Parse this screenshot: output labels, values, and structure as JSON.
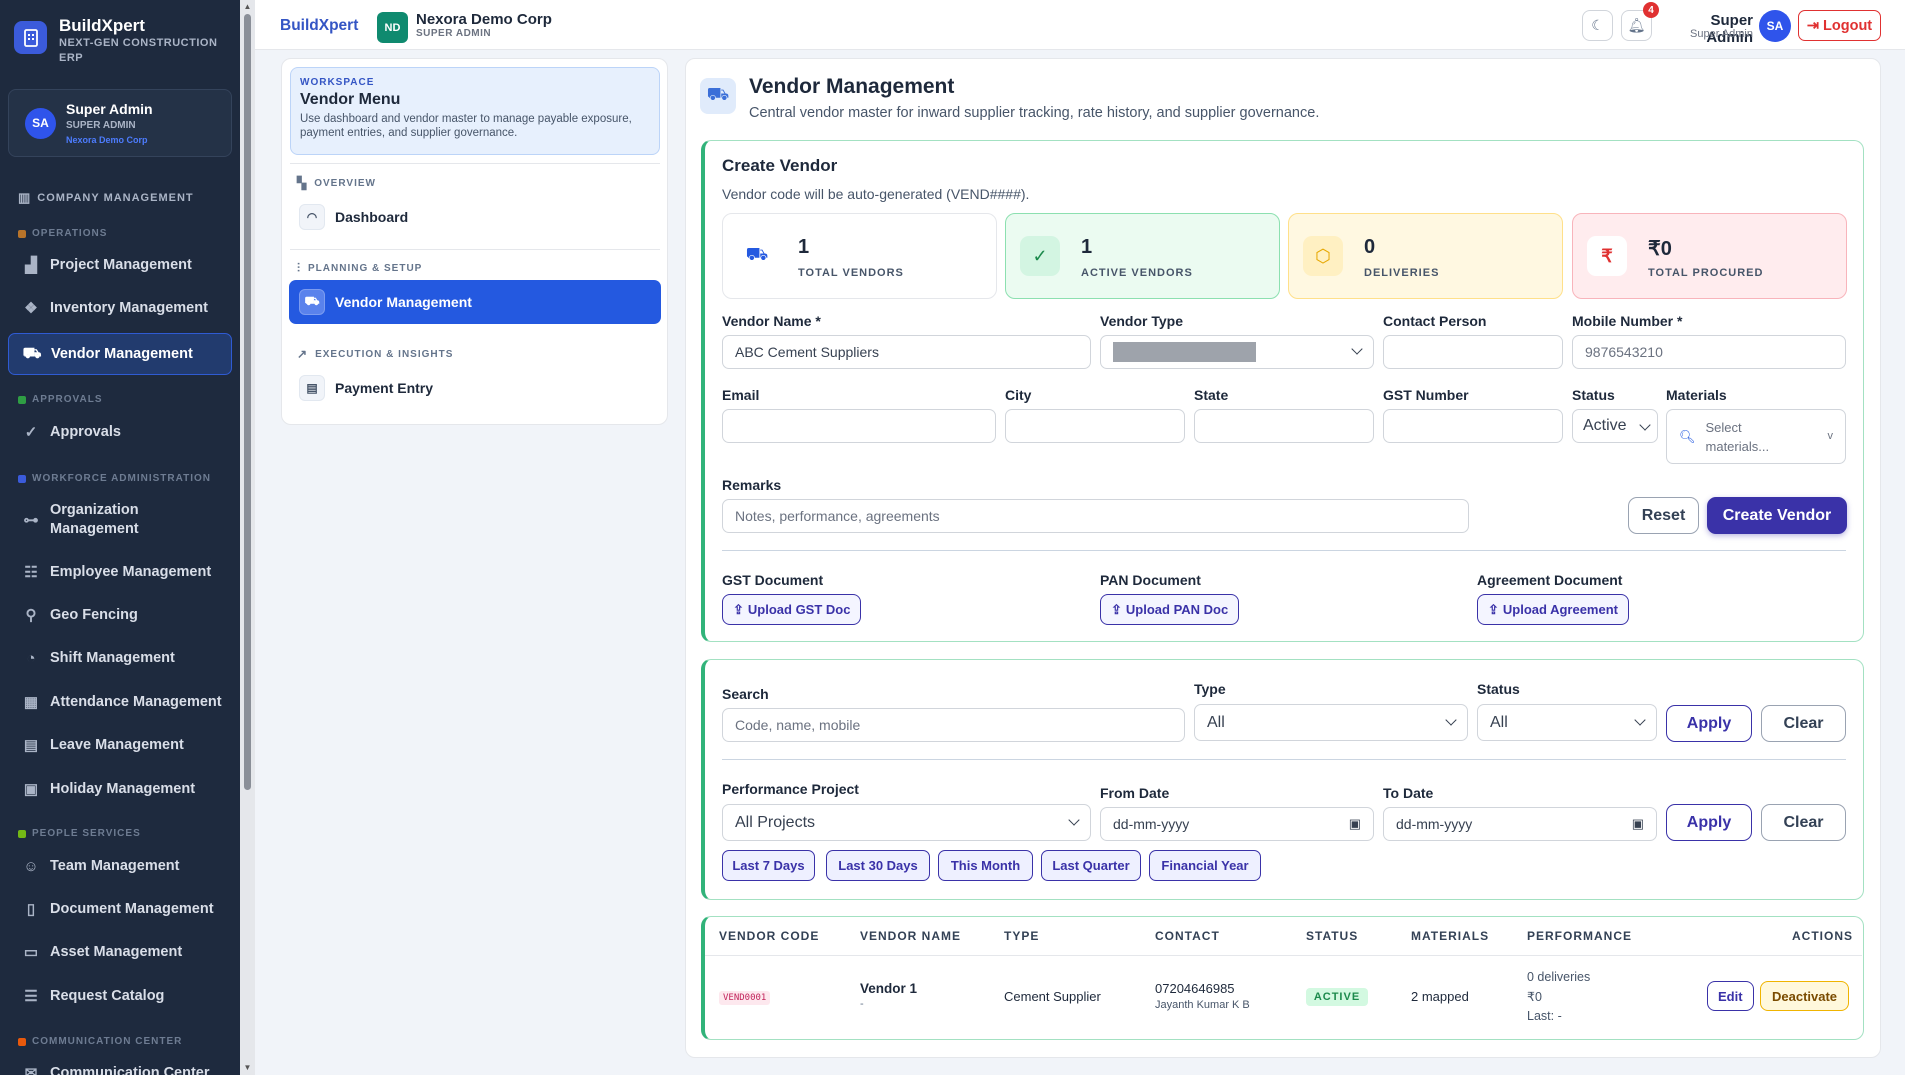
{
  "brand": {
    "name": "BuildXpert",
    "subtitle": "NEXT-GEN CONSTRUCTION ERP"
  },
  "user_card": {
    "initials": "SA",
    "name": "Super Admin",
    "role": "SUPER ADMIN",
    "company": "Nexora Demo Corp"
  },
  "sidebar": {
    "company_management": "COMPANY MANAGEMENT",
    "sections": {
      "operations": "OPERATIONS",
      "approvals": "APPROVALS",
      "workforce": "WORKFORCE ADMINISTRATION",
      "people": "PEOPLE SERVICES",
      "communication": "COMMUNICATION CENTER"
    },
    "items": [
      {
        "label": "Project Management",
        "icon": "chart-icon"
      },
      {
        "label": "Inventory Management",
        "icon": "boxes-icon"
      },
      {
        "label": "Vendor Management",
        "icon": "vendor-icon"
      },
      {
        "label": "Approvals",
        "icon": "check-circle-icon"
      },
      {
        "label": "Organization Management",
        "icon": "org-icon"
      },
      {
        "label": "Employee Management",
        "icon": "users-icon"
      },
      {
        "label": "Geo Fencing",
        "icon": "pin-icon"
      },
      {
        "label": "Shift Management",
        "icon": "clock-icon"
      },
      {
        "label": "Attendance Management",
        "icon": "attendance-icon"
      },
      {
        "label": "Leave Management",
        "icon": "calendar-icon"
      },
      {
        "label": "Holiday Management",
        "icon": "holiday-icon"
      },
      {
        "label": "Team Management",
        "icon": "team-icon"
      },
      {
        "label": "Document Management",
        "icon": "document-icon"
      },
      {
        "label": "Asset Management",
        "icon": "laptop-icon"
      },
      {
        "label": "Request Catalog",
        "icon": "list-icon"
      },
      {
        "label": "Communication Center",
        "icon": "chat-icon"
      }
    ]
  },
  "topbar": {
    "crumb": "BuildXpert",
    "corp_initials": "ND",
    "corp_name": "Nexora Demo Corp",
    "corp_role": "SUPER ADMIN",
    "notifications": "4",
    "admin_name": "Super Admin",
    "admin_role": "Super Admin",
    "admin_initials": "SA",
    "logout": "Logout"
  },
  "workspace": {
    "tag": "WORKSPACE",
    "title": "Vendor Menu",
    "desc": "Use dashboard and vendor master to manage payable exposure, payment entries, and supplier governance.",
    "overview": "OVERVIEW",
    "dashboard": "Dashboard",
    "planning": "PLANNING & SETUP",
    "vendor_management": "Vendor Management",
    "execution": "EXECUTION & INSIGHTS",
    "payment_entry": "Payment Entry"
  },
  "page": {
    "title": "Vendor Management",
    "desc": "Central vendor master for inward supplier tracking, rate history, and supplier governance."
  },
  "create": {
    "title": "Create Vendor",
    "note": "Vendor code will be auto-generated (VEND####).",
    "stats": [
      {
        "value": "1",
        "label": "TOTAL VENDORS"
      },
      {
        "value": "1",
        "label": "ACTIVE VENDORS"
      },
      {
        "value": "0",
        "label": "DELIVERIES"
      },
      {
        "value": "₹0",
        "label": "TOTAL PROCURED"
      }
    ],
    "vendor_name_label": "Vendor Name *",
    "vendor_name_value": "ABC Cement Suppliers",
    "vendor_type_label": "Vendor Type",
    "contact_label": "Contact Person",
    "mobile_label": "Mobile Number *",
    "mobile_value": "9876543210",
    "email_label": "Email",
    "city_label": "City",
    "state_label": "State",
    "gst_label": "GST Number",
    "status_label": "Status",
    "status_value": "Active",
    "materials_label": "Materials",
    "materials_placeholder": "Select materials...",
    "remarks_label": "Remarks",
    "remarks_placeholder": "Notes, performance, agreements",
    "reset": "Reset",
    "submit": "Create Vendor",
    "gst_doc_label": "GST Document",
    "gst_doc_btn": "Upload GST Doc",
    "pan_doc_label": "PAN Document",
    "pan_doc_btn": "Upload PAN Doc",
    "agr_doc_label": "Agreement Document",
    "agr_doc_btn": "Upload Agreement"
  },
  "filters": {
    "search_label": "Search",
    "search_placeholder": "Code, name, mobile",
    "type_label": "Type",
    "type_value": "All",
    "status_label": "Status",
    "status_value": "All",
    "apply": "Apply",
    "clear": "Clear",
    "project_label": "Performance Project",
    "project_value": "All Projects",
    "from_label": "From Date",
    "from_placeholder": "dd-mm-yyyy",
    "to_label": "To Date",
    "to_placeholder": "dd-mm-yyyy",
    "chips": [
      "Last 7 Days",
      "Last 30 Days",
      "This Month",
      "Last Quarter",
      "Financial Year"
    ]
  },
  "table": {
    "headers": [
      "VENDOR CODE",
      "VENDOR NAME",
      "TYPE",
      "CONTACT",
      "STATUS",
      "MATERIALS",
      "PERFORMANCE",
      "ACTIONS"
    ],
    "rows": [
      {
        "code": "VEND0001",
        "name": "Vendor 1",
        "name_sub": "-",
        "type": "Cement Supplier",
        "phone": "07204646985",
        "person": "Jayanth Kumar K B",
        "status": "ACTIVE",
        "materials": "2 mapped",
        "perf_deliveries": "0 deliveries",
        "perf_amount": "₹0",
        "perf_last": "Last: -",
        "edit": "Edit",
        "deactivate": "Deactivate"
      }
    ]
  },
  "colors": {
    "sidebar": "#1e2a3e",
    "primary": "#3a32a8",
    "accent_blue": "#2459e0",
    "success": "#31b37a",
    "danger": "#e03131"
  }
}
